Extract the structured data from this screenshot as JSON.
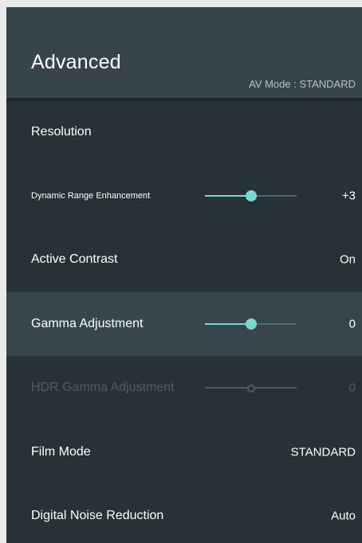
{
  "header": {
    "title": "Advanced",
    "av_mode": "AV Mode : STANDARD"
  },
  "colors": {
    "accent": "#7fd6cc",
    "panel_bg": "#273237",
    "header_bg": "#37454b",
    "selected_bg": "#37464c",
    "disabled_text": "#4f5c61"
  },
  "items": [
    {
      "label": "Resolution",
      "value": ""
    },
    {
      "label": "Dynamic Range Enhancement",
      "value": "+3",
      "slider_level": 0.5
    },
    {
      "label": "Active Contrast",
      "value": "On"
    },
    {
      "label": "Gamma Adjustment",
      "value": "0",
      "slider_level": 0.5,
      "selected": true
    },
    {
      "label": "HDR Gamma Adjustment",
      "value": "0",
      "slider_level": 0.5,
      "disabled": true
    },
    {
      "label": "Film Mode",
      "value": "STANDARD"
    },
    {
      "label": "Digital Noise Reduction",
      "value": "Auto"
    }
  ]
}
